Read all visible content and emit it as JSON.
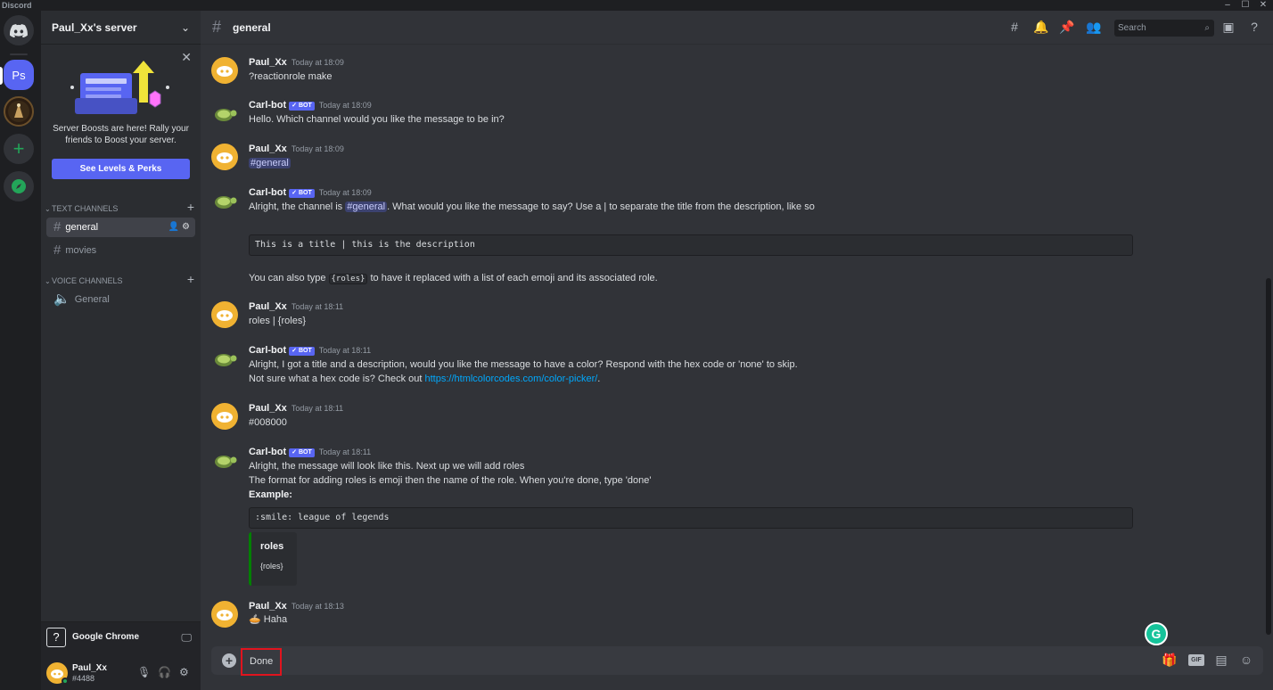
{
  "window": {
    "title": "Discord",
    "controls": [
      "–",
      "☐",
      "✕"
    ]
  },
  "rail": {
    "server_initials": "Ps"
  },
  "server": {
    "name": "Paul_Xx's server"
  },
  "boost_card": {
    "text": "Server Boosts are here! Rally your friends to Boost your server.",
    "button": "See Levels & Perks"
  },
  "categories": {
    "text": "TEXT CHANNELS",
    "voice": "VOICE CHANNELS"
  },
  "channels": {
    "text": [
      {
        "name": "general"
      },
      {
        "name": "movies"
      }
    ],
    "voice": [
      {
        "name": "General"
      }
    ]
  },
  "activity": {
    "label": "Google Chrome"
  },
  "user": {
    "name": "Paul_Xx",
    "tag": "#4488"
  },
  "header": {
    "channel": "general",
    "search_placeholder": "Search"
  },
  "messages": [
    {
      "author": "Paul_Xx",
      "time": "Today at 18:09",
      "bot": false,
      "text": "?reactionrole make"
    },
    {
      "author": "Carl-bot",
      "time": "Today at 18:09",
      "bot": true,
      "text": "Hello. Which channel would you like the message to be in?"
    },
    {
      "author": "Paul_Xx",
      "time": "Today at 18:09",
      "bot": false,
      "mention": "general"
    },
    {
      "author": "Carl-bot",
      "time": "Today at 18:09",
      "bot": true,
      "text_before": "Alright, the channel is ",
      "mention": "general",
      "text_after": ". What would you like the message to say? Use a | to separate the title from the description, like so",
      "code": "This is a title | this is the description",
      "tail_before": "You can also type ",
      "tail_code": "{roles}",
      "tail_after": " to have it replaced with a list of each emoji and its associated role."
    },
    {
      "author": "Paul_Xx",
      "time": "Today at 18:11",
      "bot": false,
      "text": "roles | {roles}"
    },
    {
      "author": "Carl-bot",
      "time": "Today at 18:11",
      "bot": true,
      "text": "Alright, I got a title and a description, would you like the message to have a color? Respond with the hex code or 'none' to skip.",
      "text2_before": "Not sure what a hex code is? Check out ",
      "link": "https://htmlcolorcodes.com/color-picker/",
      "text2_after": "."
    },
    {
      "author": "Paul_Xx",
      "time": "Today at 18:11",
      "bot": false,
      "text": "#008000"
    },
    {
      "author": "Carl-bot",
      "time": "Today at 18:11",
      "bot": true,
      "text": "Alright, the message will look like this. Next up we will add roles",
      "text2": "The format for adding roles is emoji then the name of the role. When you're done, type 'done'",
      "example_label": "Example:",
      "code": ":smile: league of legends",
      "embed_title": "roles",
      "embed_desc": "{roles}"
    },
    {
      "author": "Paul_Xx",
      "time": "Today at 18:13",
      "bot": false,
      "text": "Haha"
    }
  ],
  "bot_badge": "✓ BOT",
  "composer": {
    "value": "Done"
  },
  "icons": {
    "gif": "GIF"
  },
  "colors": {
    "accent": "#5865f2",
    "embed_bar": "#008000",
    "highlight_box": "#e0141e"
  }
}
